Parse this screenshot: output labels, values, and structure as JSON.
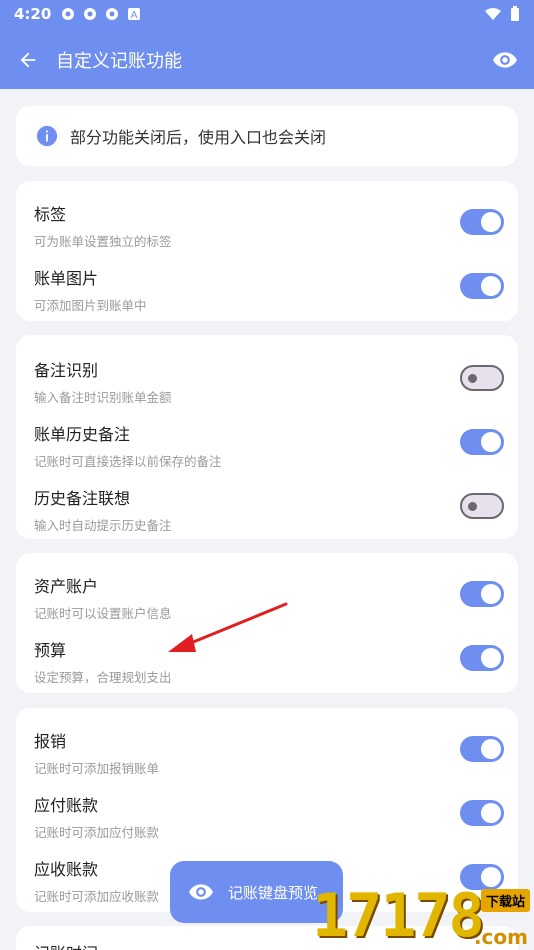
{
  "status": {
    "time": "4:20",
    "icons": [
      "app-icon",
      "app-icon",
      "app-icon",
      "A-icon"
    ],
    "right_icons": [
      "wifi-icon",
      "battery-icon"
    ]
  },
  "appbar": {
    "title": "自定义记账功能",
    "back_icon": "arrow-left-icon",
    "action_icon": "eye-icon"
  },
  "info": {
    "text": "部分功能关闭后，使用入口也会关闭",
    "icon": "info-icon"
  },
  "groups": [
    {
      "items": [
        {
          "title": "标签",
          "subtitle": "可为账单设置独立的标签",
          "enabled": true
        },
        {
          "title": "账单图片",
          "subtitle": "可添加图片到账单中",
          "enabled": true
        }
      ]
    },
    {
      "items": [
        {
          "title": "备注识别",
          "subtitle": "输入备注时识别账单金额",
          "enabled": false
        },
        {
          "title": "账单历史备注",
          "subtitle": "记账时可直接选择以前保存的备注",
          "enabled": true
        },
        {
          "title": "历史备注联想",
          "subtitle": "输入时自动提示历史备注",
          "enabled": false
        }
      ]
    },
    {
      "items": [
        {
          "title": "资产账户",
          "subtitle": "记账时可以设置账户信息",
          "enabled": true
        },
        {
          "title": "预算",
          "subtitle": "设定预算，合理规划支出",
          "enabled": true
        }
      ]
    },
    {
      "items": [
        {
          "title": "报销",
          "subtitle": "记账时可添加报销账单",
          "enabled": true
        },
        {
          "title": "应付账款",
          "subtitle": "记账时可添加应付账款",
          "enabled": true
        },
        {
          "title": "应收账款",
          "subtitle": "记账时可添加应收账款",
          "enabled": true
        }
      ]
    },
    {
      "items": [
        {
          "title": "记账时间",
          "subtitle": "",
          "enabled": true
        }
      ]
    }
  ],
  "fab": {
    "label": "记账键盘预览",
    "icon": "eye-icon"
  },
  "watermark": {
    "digits": "17178",
    "badge": "下载站",
    "domain": ".com"
  },
  "colors": {
    "accent": "#6f8ff0",
    "background": "#f2f3f7",
    "arrow": "#e02020"
  }
}
